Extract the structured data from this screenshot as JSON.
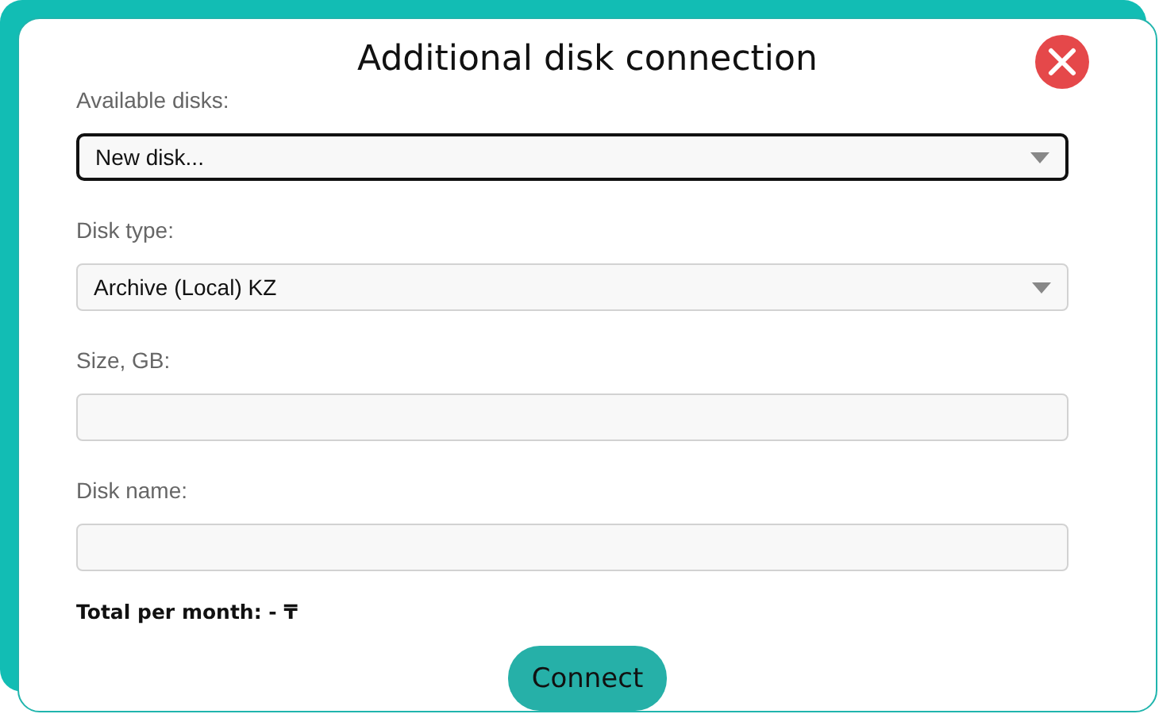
{
  "dialog": {
    "title": "Additional disk connection"
  },
  "fields": [
    {
      "label": "Available disks:",
      "kind": "select",
      "value": "New disk...",
      "focused": true
    },
    {
      "label": "Disk type:",
      "kind": "select",
      "value": "Archive (Local) KZ",
      "focused": false
    },
    {
      "label": "Size, GB:",
      "kind": "input",
      "focused": false
    },
    {
      "label": "Disk name:",
      "kind": "input",
      "focused": false
    }
  ],
  "total": "Total per month: - ₸",
  "buttons": [
    "Connect"
  ]
}
